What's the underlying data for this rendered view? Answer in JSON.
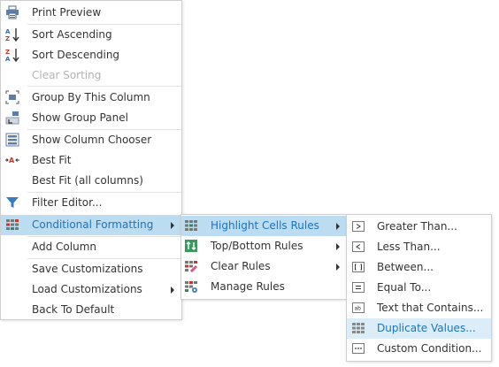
{
  "menu_main": {
    "items": [
      {
        "label": "Print Preview"
      },
      {
        "label": "Sort Ascending"
      },
      {
        "label": "Sort Descending"
      },
      {
        "label": "Clear Sorting"
      },
      {
        "label": "Group By This Column"
      },
      {
        "label": "Show Group Panel"
      },
      {
        "label": "Show Column Chooser"
      },
      {
        "label": "Best Fit"
      },
      {
        "label": "Best Fit (all columns)"
      },
      {
        "label": "Filter Editor..."
      },
      {
        "label": "Conditional Formatting"
      },
      {
        "label": "Add Column"
      },
      {
        "label": "Save Customizations"
      },
      {
        "label": "Load Customizations"
      },
      {
        "label": "Back To Default"
      }
    ]
  },
  "menu_conditional": {
    "items": [
      {
        "label": "Highlight Cells Rules"
      },
      {
        "label": "Top/Bottom Rules"
      },
      {
        "label": "Clear Rules"
      },
      {
        "label": "Manage Rules"
      }
    ]
  },
  "menu_highlight": {
    "items": [
      {
        "label": "Greater Than..."
      },
      {
        "label": "Less Than..."
      },
      {
        "label": "Between..."
      },
      {
        "label": "Equal To..."
      },
      {
        "label": "Text that Contains..."
      },
      {
        "label": "Duplicate Values..."
      },
      {
        "label": "Custom Condition..."
      }
    ]
  },
  "colors": {
    "highlight_bg": "#bcdcf2",
    "hover_bg": "#dbedf9",
    "highlight_text": "#1a74c0",
    "disabled_text": "#b3b3b3"
  }
}
